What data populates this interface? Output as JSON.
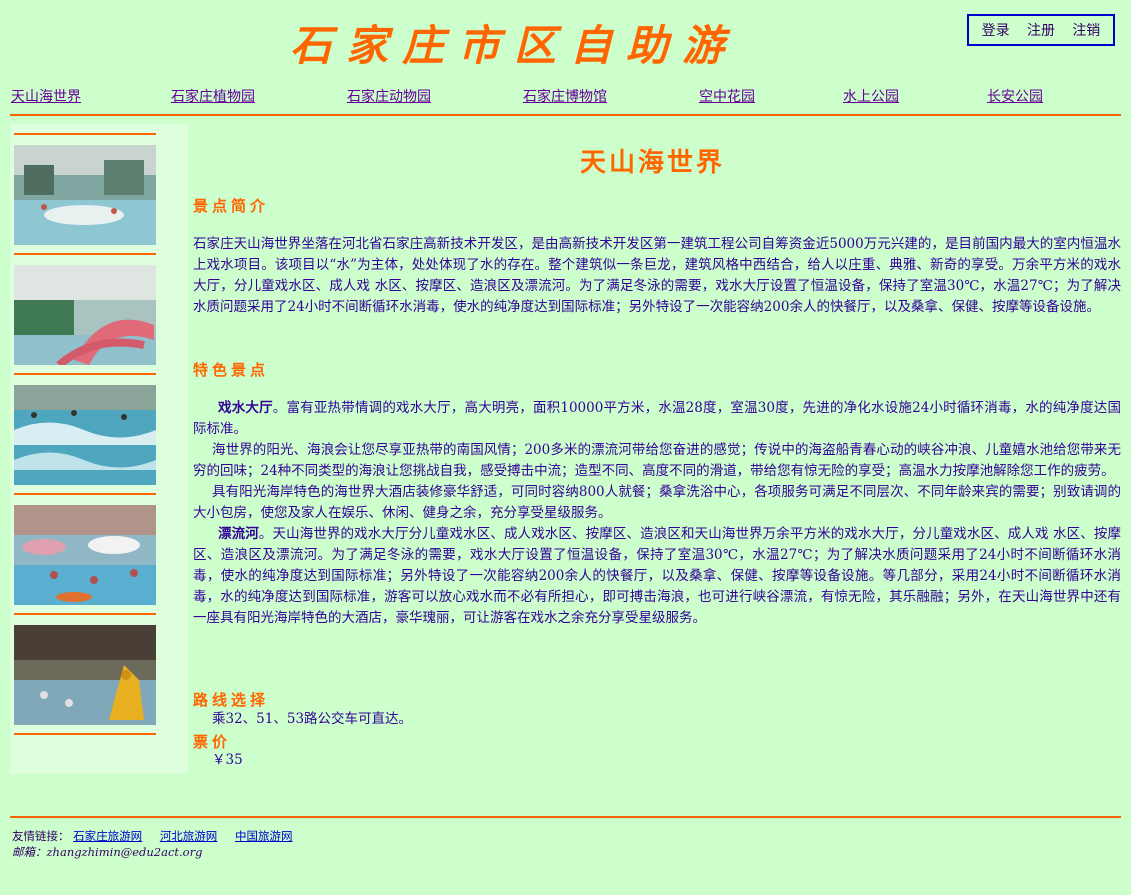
{
  "site": {
    "title": "石家庄市区自助游"
  },
  "auth": {
    "login": "登录",
    "register": "注册",
    "logout": "注销"
  },
  "nav": {
    "items": [
      {
        "label": "天山海世界"
      },
      {
        "label": "石家庄植物园"
      },
      {
        "label": "石家庄动物园"
      },
      {
        "label": "石家庄博物馆"
      },
      {
        "label": "空中花园"
      },
      {
        "label": "水上公园"
      },
      {
        "label": "长安公园"
      }
    ]
  },
  "main": {
    "title": "天山海世界",
    "intro_heading": "景点简介",
    "intro_text": "石家庄天山海世界坐落在河北省石家庄高新技术开发区，是由高新技术开发区第一建筑工程公司自筹资金近5000万元兴建的，是目前国内最大的室内恒温水上戏水项目。该项目以“水”为主体，处处体现了水的存在。整个建筑似一条巨龙，建筑风格中西结合，给人以庄重、典雅、新奇的享受。万余平方米的戏水大厅，分儿童戏水区、成人戏 水区、按摩区、造浪区及漂流河。为了满足冬泳的需要，戏水大厅设置了恒温设备，保持了室温30℃，水温27℃；为了解决水质问题采用了24小时不间断循环水消毒，使水的纯净度达到国际标准；另外特设了一次能容纳200余人的快餐厅，以及桑拿、保健、按摩等设备设施。",
    "feature_heading": "特色景点",
    "feature_1_title": "戏水大厅",
    "feature_1_text": "。富有亚热带情调的戏水大厅，高大明亮，面积10000平方米，水温28度，室温30度，先进的净化水设施24小时循环消毒，水的纯净度达国际标准。",
    "feature_2_text": "海世界的阳光、海浪会让您尽享亚热带的南国风情；200多米的漂流河带给您奋进的感觉；传说中的海盗船青春心动的峡谷冲浪、儿童嬉水池给您带来无穷的回味；24种不同类型的海浪让您挑战自我，感受搏击中流；造型不同、高度不同的滑道，带给您有惊无险的享受；高温水力按摩池解除您工作的疲劳。",
    "feature_3_text": "具有阳光海岸特色的海世界大酒店装修豪华舒适，可同时容纳800人就餐；桑拿洗浴中心，各项服务可满足不同层次、不同年龄来宾的需要；别致请调的大小包房，使您及家人在娱乐、休闲、健身之余，充分享受星级服务。",
    "feature_4_title": "漂流河",
    "feature_4_text": "。天山海世界的戏水大厅分儿童戏水区、成人戏水区、按摩区、造浪区和天山海世界万余平方米的戏水大厅，分儿童戏水区、成人戏 水区、按摩区、造浪区及漂流河。为了满足冬泳的需要，戏水大厅设置了恒温设备，保持了室温30℃，水温27℃；为了解决水质问题采用了24小时不间断循环水消毒，使水的纯净度达到国际标准；另外特设了一次能容纳200余人的快餐厅，以及桑拿、保健、按摩等设备设施。等几部分，采用24小时不间断循环水消毒，水的纯净度达到国际标准，游客可以放心戏水而不必有所担心，即可搏击海浪，也可进行峡谷漂流，有惊无险，其乐融融；另外，在天山海世界中还有一座具有阳光海岸特色的大酒店，豪华瑰丽，可让游客在戏水之余充分享受星级服务。",
    "route_heading": "路线选择",
    "route_text": "乘32、51、53路公交车可直达。",
    "ticket_heading": "票价",
    "ticket_text": "￥35"
  },
  "footer": {
    "links_label": "友情链接：",
    "links": [
      {
        "label": "石家庄旅游网"
      },
      {
        "label": "河北旅游网"
      },
      {
        "label": "中国旅游网"
      }
    ],
    "email_label": "邮箱：",
    "email": "zhangzhimin@edu2act.org"
  },
  "colors": {
    "background": "#ccffcc",
    "accent": "#ff6600",
    "text": "#330099",
    "link": "#0000cc"
  }
}
